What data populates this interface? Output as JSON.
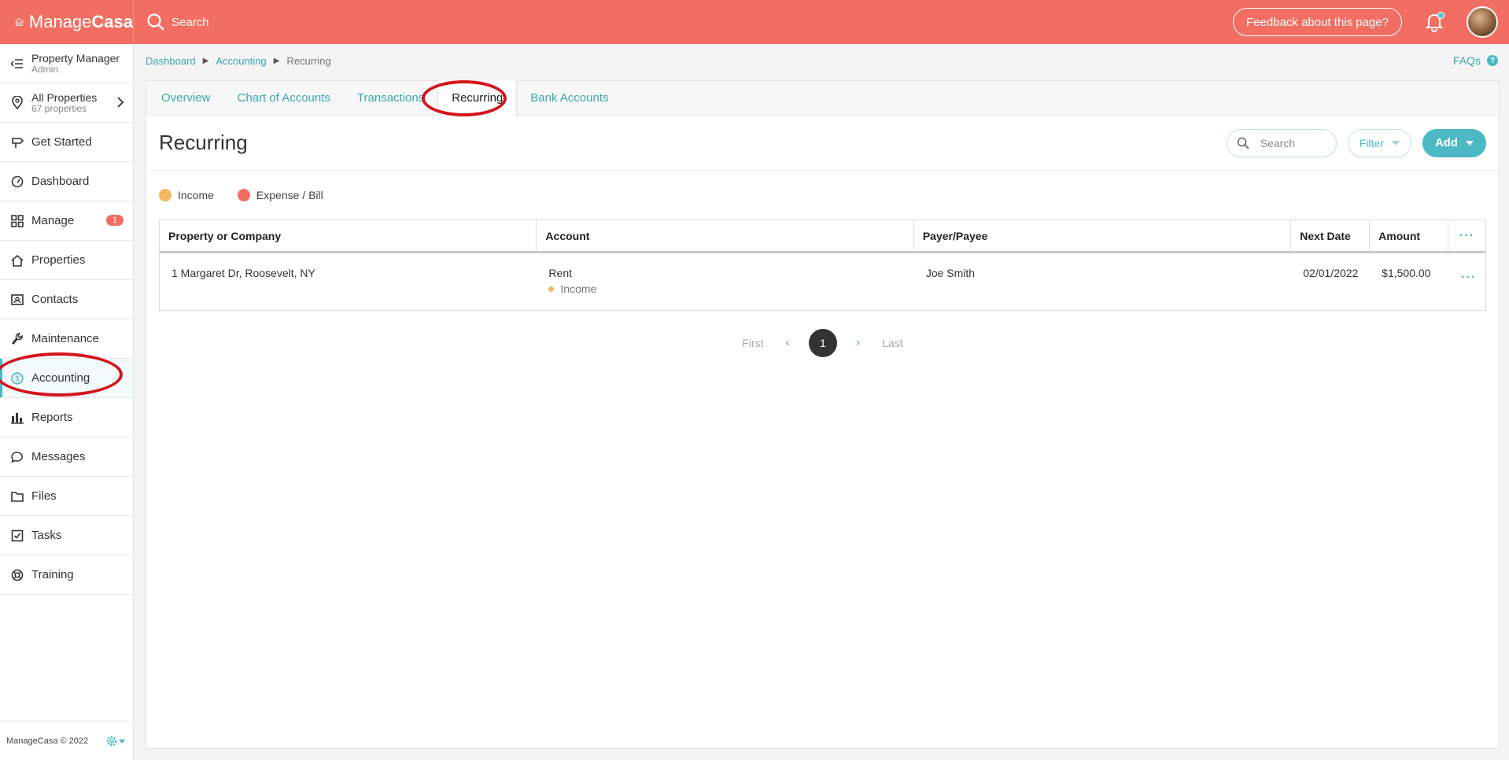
{
  "app": {
    "logo_light": "Manage",
    "logo_bold": "Casa",
    "search_label": "Search",
    "feedback_label": "Feedback about this page?"
  },
  "sidebar": {
    "user": {
      "name": "Property Manager",
      "role": "Admin"
    },
    "properties": {
      "name": "All Properties",
      "count": "67 properties"
    },
    "items": [
      {
        "label": "Get Started"
      },
      {
        "label": "Dashboard"
      },
      {
        "label": "Manage",
        "badge": "1"
      },
      {
        "label": "Properties"
      },
      {
        "label": "Contacts"
      },
      {
        "label": "Maintenance"
      },
      {
        "label": "Accounting"
      },
      {
        "label": "Reports"
      },
      {
        "label": "Messages"
      },
      {
        "label": "Files"
      },
      {
        "label": "Tasks"
      },
      {
        "label": "Training"
      }
    ],
    "footer": "ManageCasa © 2022"
  },
  "breadcrumb": [
    "Dashboard",
    "Accounting",
    "Recurring"
  ],
  "faqs_label": "FAQs",
  "tabs": [
    "Overview",
    "Chart of Accounts",
    "Transactions",
    "Recurring",
    "Bank Accounts"
  ],
  "page": {
    "title": "Recurring",
    "search_placeholder": "Search",
    "filter_label": "Filter",
    "add_label": "Add"
  },
  "legend": [
    {
      "label": "Income",
      "color": "#f3b862"
    },
    {
      "label": "Expense / Bill",
      "color": "#f26e62"
    }
  ],
  "table": {
    "columns": [
      "Property or Company",
      "Account",
      "Payer/Payee",
      "Next Date",
      "Amount"
    ],
    "rows": [
      {
        "property": "1 Margaret Dr, Roosevelt, NY",
        "account": "Rent",
        "account_type": "Income",
        "payee": "Joe Smith",
        "next_date": "02/01/2022",
        "amount": "$1,500.00"
      }
    ]
  },
  "pager": {
    "first": "First",
    "current": "1",
    "last": "Last"
  },
  "colors": {
    "brand": "#f26e62",
    "accent": "#4bb8c3",
    "annotation": "#d3141b"
  }
}
